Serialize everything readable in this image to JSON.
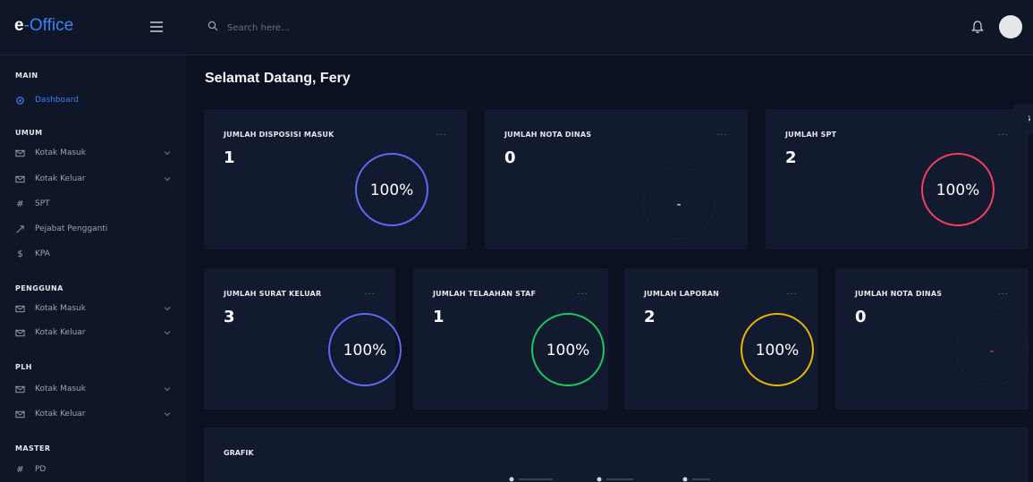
{
  "brand": {
    "prefix": "e",
    "name": "-Office"
  },
  "search": {
    "placeholder": "Search here..."
  },
  "sidebar": {
    "sections": [
      {
        "title": "MAIN",
        "items": [
          {
            "label": "Dashboard",
            "icon": "dashboard-icon",
            "active": true
          }
        ]
      },
      {
        "title": "UMUM",
        "items": [
          {
            "label": "Kotak Masuk",
            "icon": "mail-icon",
            "chevron": true
          },
          {
            "label": "Kotak Keluar",
            "icon": "mail-icon",
            "chevron": true
          },
          {
            "label": "SPT",
            "icon": "hash-icon"
          },
          {
            "label": "Pejabat Pengganti",
            "icon": "expand-icon"
          },
          {
            "label": "KPA",
            "icon": "dollar-icon"
          }
        ]
      },
      {
        "title": "PENGGUNA",
        "items": [
          {
            "label": "Kotak Masuk",
            "icon": "mail-icon",
            "chevron": true
          },
          {
            "label": "Kotak Keluar",
            "icon": "mail-icon",
            "chevron": true
          }
        ]
      },
      {
        "title": "PLH",
        "items": [
          {
            "label": "Kotak Masuk",
            "icon": "mail-icon",
            "chevron": true
          },
          {
            "label": "Kotak Keluar",
            "icon": "mail-icon",
            "chevron": true
          }
        ]
      },
      {
        "title": "MASTER",
        "items": [
          {
            "label": "PD",
            "icon": "hash-icon"
          }
        ]
      }
    ]
  },
  "main": {
    "greeting": "Selamat Datang, Fery",
    "dots": "...",
    "cards_row1": [
      {
        "title": "JUMLAH DISPOSISI MASUK",
        "value": "1",
        "percent": "100%",
        "ring_color": "#6366f1",
        "fill_fraction": 1
      },
      {
        "title": "JUMLAH NOTA DINAS",
        "value": "0",
        "percent": "-",
        "ring_color": "#1f2937",
        "fill_fraction": 0
      },
      {
        "title": "JUMLAH SPT",
        "value": "2",
        "percent": "100%",
        "ring_color": "#f43f5e",
        "fill_fraction": 1
      }
    ],
    "cards_row2": [
      {
        "title": "JUMLAH SURAT KELUAR",
        "value": "3",
        "percent": "100%",
        "ring_color": "#6366f1",
        "fill_fraction": 1
      },
      {
        "title": "JUMLAH TELAAHAN STAF",
        "value": "1",
        "percent": "100%",
        "ring_color": "#22c55e",
        "fill_fraction": 1
      },
      {
        "title": "JUMLAH LAPORAN",
        "value": "2",
        "percent": "100%",
        "ring_color": "#eab308",
        "fill_fraction": 1
      },
      {
        "title": "JUMLAH NOTA DINAS",
        "value": "0",
        "percent": "-",
        "ring_color": "#1f2937",
        "fill_fraction": 0,
        "text_color": "#f43f5e"
      }
    ],
    "grafik": {
      "title": "GRAFIK"
    }
  }
}
